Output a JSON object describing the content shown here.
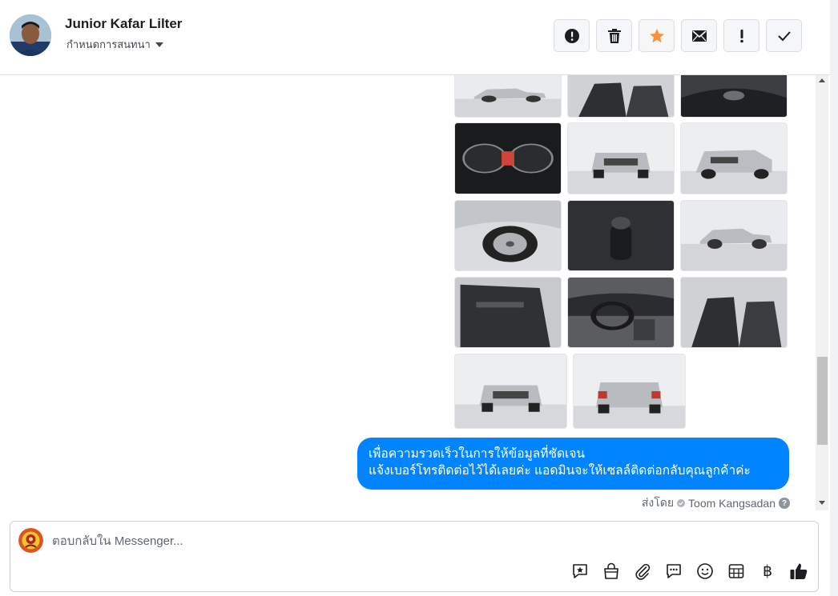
{
  "header": {
    "contact_name": "Junior Kafar Lilter",
    "assign_label": "กำหนดการสนทนา",
    "actions": [
      {
        "name": "spam-button",
        "icon": "alert-circle-icon"
      },
      {
        "name": "delete-button",
        "icon": "trash-icon"
      },
      {
        "name": "star-button",
        "icon": "star-icon",
        "color": "#f7923b"
      },
      {
        "name": "mark-unread-button",
        "icon": "envelope-icon"
      },
      {
        "name": "follow-up-button",
        "icon": "exclamation-icon"
      },
      {
        "name": "done-button",
        "icon": "check-icon"
      }
    ]
  },
  "thread": {
    "photos": [
      {
        "kind": "car-side"
      },
      {
        "kind": "interior-seats"
      },
      {
        "kind": "interior-dark"
      },
      {
        "kind": "gauges"
      },
      {
        "kind": "car-front"
      },
      {
        "kind": "car-front-angle"
      },
      {
        "kind": "wheel"
      },
      {
        "kind": "gear-shift"
      },
      {
        "kind": "car-side"
      },
      {
        "kind": "door-panel"
      },
      {
        "kind": "dashboard"
      },
      {
        "kind": "interior-seats"
      },
      {
        "kind": "car-front"
      },
      {
        "kind": "car-rear"
      }
    ],
    "message": {
      "line1": "เพื่อความรวดเร็วในการให้ข้อมูลที่ชัดเจน",
      "line2": "แจ้งเบอร์โทรติดต่อไว้ได้เลยค่ะ แอดมินจะให้เซลล์ติดต่อกลับคุณลูกค้าค่ะ",
      "color": "#0084ff"
    },
    "sent_by_label": "ส่งโดย",
    "sender": "Toom Kangsadan"
  },
  "composer": {
    "placeholder": "ตอบกลับใน Messenger...",
    "tools": [
      "saved-reply-icon",
      "shop-bag-icon",
      "attachment-icon",
      "chat-bubble-icon",
      "emoji-icon",
      "calendar-icon",
      "baht-icon",
      "thumbs-up-icon"
    ],
    "baht_symbol": "฿"
  }
}
